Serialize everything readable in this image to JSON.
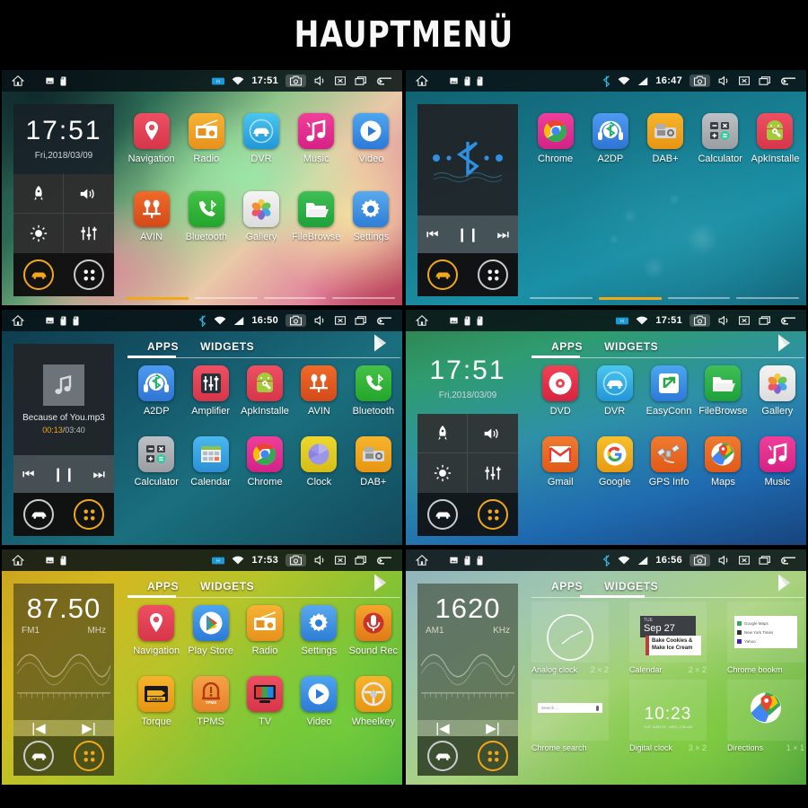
{
  "header": {
    "title": "HAUPTMENÜ"
  },
  "common": {
    "statusbar_icons": [
      "home-icon",
      "image-icon",
      "sdcard-icon",
      "sdcard2-icon"
    ],
    "right_icons": [
      "camera-icon",
      "volume-icon",
      "close-icon",
      "recents-icon",
      "back-icon"
    ],
    "dock_toggles": [
      "rocket-icon",
      "volume-icon",
      "brightness-icon",
      "equalizer-icon"
    ],
    "dock_buttons": [
      "car-icon",
      "apps-icon"
    ],
    "transport": [
      "prev-icon",
      "pause-icon",
      "next-icon"
    ],
    "tabs": {
      "apps": "APPS",
      "widgets": "WIDGETS"
    }
  },
  "panels": [
    {
      "id": "home-colorful",
      "status": {
        "time": "17:51",
        "signal": "hsdpa-icon",
        "wifi": "wifi-icon"
      },
      "dock": {
        "type": "clock",
        "time": "17:51",
        "date": "Fri,2018/03/09",
        "active": "car"
      },
      "view": "home",
      "pages": 4,
      "active_page": 1,
      "apps": [
        [
          {
            "label": "Navigation",
            "icon": "navigation-pin",
            "c1": "#ef4f62",
            "c2": "#d6354a"
          },
          {
            "label": "Radio",
            "icon": "radio",
            "c1": "#f5b335",
            "c2": "#e8911d"
          },
          {
            "label": "DVR",
            "icon": "dvr-car",
            "c1": "#4bc6f0",
            "c2": "#2196d8"
          },
          {
            "label": "Music",
            "icon": "music-note",
            "c1": "#ef3f9a",
            "c2": "#d62184"
          },
          {
            "label": "Video",
            "icon": "play-circle",
            "c1": "#4da6f0",
            "c2": "#2d79d8"
          }
        ],
        [
          {
            "label": "AVIN",
            "icon": "avin-plug",
            "c1": "#f06a28",
            "c2": "#d4491a"
          },
          {
            "label": "Bluetooth",
            "icon": "bt-phone",
            "c1": "#45c247",
            "c2": "#23a52b"
          },
          {
            "label": "Gallery",
            "icon": "gallery-flower",
            "c1": "#f2f2f2",
            "c2": "#dcdcdc"
          },
          {
            "label": "FileBrowse",
            "icon": "folder",
            "c1": "#3fbf55",
            "c2": "#1ea13a"
          },
          {
            "label": "Settings",
            "icon": "gear",
            "c1": "#59a9ef",
            "c2": "#2d7ed6"
          }
        ]
      ]
    },
    {
      "id": "home-water",
      "status": {
        "time": "16:47",
        "signal": "signal-icon",
        "wifi": "wifi-icon",
        "bt": "bluetooth-icon"
      },
      "dock": {
        "type": "bluetooth",
        "active": "car"
      },
      "view": "home",
      "pages": 4,
      "active_page": 2,
      "apps": [
        [
          {
            "label": "Chrome",
            "icon": "chrome",
            "c1": "#ee3f9c",
            "c2": "#d22286"
          },
          {
            "label": "A2DP",
            "icon": "a2dp-headset",
            "c1": "#4f9bf0",
            "c2": "#2f75d4"
          },
          {
            "label": "DAB+",
            "icon": "dab-radio",
            "c1": "#f6b42c",
            "c2": "#e79513"
          },
          {
            "label": "Calculator",
            "icon": "calculator",
            "c1": "#b9bcc0",
            "c2": "#9a9ea3"
          },
          {
            "label": "ApkInstalle",
            "icon": "android-wrench",
            "c1": "#ef4f62",
            "c2": "#d6354a"
          }
        ]
      ]
    },
    {
      "id": "drawer-apps-1",
      "status": {
        "time": "16:50",
        "signal": "signal-icon",
        "wifi": "wifi-icon",
        "bt": "bluetooth-icon"
      },
      "dock": {
        "type": "media",
        "track": "Because of You.mp3",
        "current": "00:13",
        "total": "/03:40",
        "active": "apps"
      },
      "view": "drawer",
      "selected_tab": "APPS",
      "apps": [
        [
          {
            "label": "A2DP",
            "icon": "a2dp-headset",
            "c1": "#4f9bf0",
            "c2": "#2f75d4"
          },
          {
            "label": "Amplifier",
            "icon": "equalizer-box",
            "c1": "#ef4f62",
            "c2": "#d6354a"
          },
          {
            "label": "ApkInstalle",
            "icon": "android-wrench",
            "c1": "#ef4f62",
            "c2": "#d6354a"
          },
          {
            "label": "AVIN",
            "icon": "avin-plug",
            "c1": "#f06a28",
            "c2": "#d4491a"
          },
          {
            "label": "Bluetooth",
            "icon": "bt-phone",
            "c1": "#45c247",
            "c2": "#23a52b"
          }
        ],
        [
          {
            "label": "Calculator",
            "icon": "calculator",
            "c1": "#b9bcc0",
            "c2": "#9a9ea3"
          },
          {
            "label": "Calendar",
            "icon": "calendar-grid",
            "c1": "#4ab8ef",
            "c2": "#2c8fd4"
          },
          {
            "label": "Chrome",
            "icon": "chrome",
            "c1": "#ee3f9c",
            "c2": "#d22286"
          },
          {
            "label": "Clock",
            "icon": "clock-cube",
            "c1": "#edd82e",
            "c2": "#d5bd16"
          },
          {
            "label": "DAB+",
            "icon": "dab-radio",
            "c1": "#f6b42c",
            "c2": "#e79513"
          }
        ]
      ]
    },
    {
      "id": "drawer-apps-2",
      "status": {
        "time": "17:51",
        "signal": "hsdpa-icon",
        "wifi": "wifi-icon"
      },
      "dock": {
        "type": "clock",
        "time": "17:51",
        "date": "Fri,2018/03/09",
        "active": "apps"
      },
      "view": "drawer",
      "selected_tab": "APPS",
      "apps": [
        [
          {
            "label": "DVD",
            "icon": "disc",
            "c1": "#ef4256",
            "c2": "#d52440"
          },
          {
            "label": "DVR",
            "icon": "dvr-car",
            "c1": "#4bc6f0",
            "c2": "#2196d8"
          },
          {
            "label": "EasyConn",
            "icon": "easyconnect",
            "c1": "#4da6f0",
            "c2": "#2d79d8"
          },
          {
            "label": "FileBrowse",
            "icon": "folder",
            "c1": "#3fbf55",
            "c2": "#1ea13a"
          },
          {
            "label": "Gallery",
            "icon": "gallery-flower",
            "c1": "#f2f2f2",
            "c2": "#dcdcdc"
          }
        ],
        [
          {
            "label": "Gmail",
            "icon": "gmail",
            "c1": "#f07a30",
            "c2": "#e05a18"
          },
          {
            "label": "Google",
            "icon": "google-g",
            "c1": "#f6c02c",
            "c2": "#e79a13"
          },
          {
            "label": "GPS Info",
            "icon": "satellite",
            "c1": "#f07a30",
            "c2": "#e05a18"
          },
          {
            "label": "Maps",
            "icon": "maps-pin",
            "c1": "#f07a30",
            "c2": "#e05a18"
          },
          {
            "label": "Music",
            "icon": "music-note",
            "c1": "#ef3f9a",
            "c2": "#d62184"
          }
        ]
      ]
    },
    {
      "id": "drawer-apps-3",
      "status": {
        "time": "17:53",
        "signal": "hsdpa-icon",
        "wifi": "wifi-icon"
      },
      "dock": {
        "type": "radio",
        "freq": "87.50",
        "band": "FM1",
        "unit": "MHz",
        "active": "apps"
      },
      "view": "drawer",
      "selected_tab": "APPS",
      "apps": [
        [
          {
            "label": "Navigation",
            "icon": "navigation-pin",
            "c1": "#ef4f62",
            "c2": "#d6354a"
          },
          {
            "label": "Play Store",
            "icon": "play-store",
            "c1": "#4da6f0",
            "c2": "#2d79d8"
          },
          {
            "label": "Radio",
            "icon": "radio",
            "c1": "#f5b335",
            "c2": "#e8911d"
          },
          {
            "label": "Settings",
            "icon": "gear",
            "c1": "#59a9ef",
            "c2": "#2d7ed6"
          },
          {
            "label": "Sound Rec",
            "icon": "microphone",
            "c1": "#f5a52c",
            "c2": "#e07a18"
          }
        ],
        [
          {
            "label": "Torque",
            "icon": "torque-check",
            "c1": "#f6b42c",
            "c2": "#e79513"
          },
          {
            "label": "TPMS",
            "icon": "tpms",
            "c1": "#f5a247",
            "c2": "#e8822a"
          },
          {
            "label": "TV",
            "icon": "tv-screen",
            "c1": "#ef4f62",
            "c2": "#d6354a"
          },
          {
            "label": "Video",
            "icon": "play-circle",
            "c1": "#4da6f0",
            "c2": "#2d79d8"
          },
          {
            "label": "Wheelkey",
            "icon": "steering-wheel",
            "c1": "#f6b42c",
            "c2": "#e79513"
          }
        ]
      ]
    },
    {
      "id": "drawer-widgets",
      "status": {
        "time": "16:56",
        "signal": "signal-icon",
        "wifi": "wifi-icon",
        "bt": "bluetooth-icon"
      },
      "dock": {
        "type": "radio",
        "freq": "1620",
        "band": "AM1",
        "unit": "KHz",
        "active": "apps"
      },
      "view": "widgets",
      "selected_tab": "WIDGETS",
      "widgets": [
        [
          {
            "name": "Analog clock",
            "size": "2 × 2",
            "thumb": "analog-clock"
          },
          {
            "name": "Calendar",
            "size": "2 × 2",
            "thumb": "calendar"
          },
          {
            "name": "Chrome bookm",
            "size": "",
            "thumb": "chrome-bookmarks"
          }
        ],
        [
          {
            "name": "Chrome search",
            "size": "",
            "thumb": "chrome-search"
          },
          {
            "name": "Digital clock",
            "size": "3 × 2",
            "thumb": "digital-clock"
          },
          {
            "name": "Directions",
            "size": "1 × 1",
            "thumb": "directions"
          }
        ]
      ],
      "widget_details": {
        "calendar_day": "TUE",
        "calendar_date": "Sep 27",
        "calendar_event1": "Bake Cookies &",
        "calendar_event2": "Make Ice Cream",
        "bookmarks": [
          "Google Maps",
          "New York Times",
          "Yahoo"
        ],
        "search_placeholder": "Search ...",
        "digital_time": "10:23",
        "digital_sub": "TUE, MAR 04  ·  WED, 2:30 AM"
      }
    }
  ]
}
